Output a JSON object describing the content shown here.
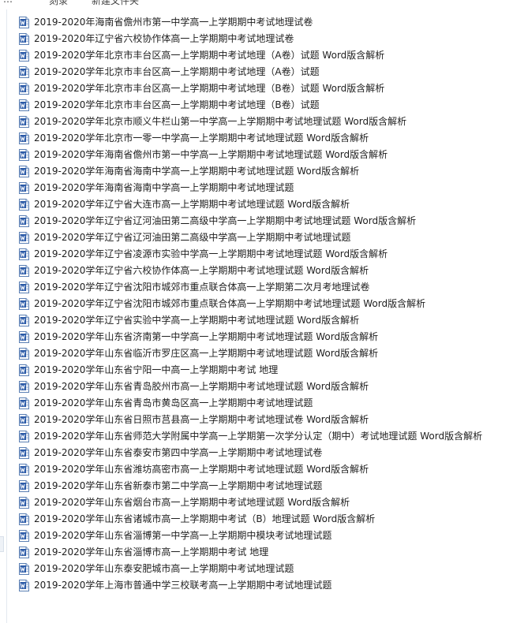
{
  "toolbar": {
    "partial_labels": [
      "…",
      "刻录",
      "新建文件夹"
    ]
  },
  "file_list": {
    "icon": "word-document-icon",
    "items": [
      "2019-2020年海南省儋州市第一中学高一上学期期中考试地理试卷",
      "2019-2020年辽宁省六校协作体高一上学期期中考试地理试卷",
      "2019-2020学年北京市丰台区高一上学期期中考试地理（A卷）试题 Word版含解析",
      "2019-2020学年北京市丰台区高一上学期期中考试地理（A卷）试题",
      "2019-2020学年北京市丰台区高一上学期期中考试地理（B卷）试题 Word版含解析",
      "2019-2020学年北京市丰台区高一上学期期中考试地理（B卷）试题",
      "2019-2020学年北京市顺义牛栏山第一中学高一上学期期中考试地理试题 Word版含解析",
      "2019-2020学年北京市一零一中学高一上学期期中考试地理试题 Word版含解析",
      "2019-2020学年海南省儋州市第一中学高一上学期期中考试地理试题 Word版含解析",
      "2019-2020学年海南省海南中学高一上学期期中考试地理试题 Word版含解析",
      "2019-2020学年海南省海南中学高一上学期期中考试地理试题",
      "2019-2020学年辽宁省大连市高一上学期期中考试地理试题 Word版含解析",
      "2019-2020学年辽宁省辽河油田第二高级中学高一上学期期中考试地理试题 Word版含解析",
      "2019-2020学年辽宁省辽河油田第二高级中学高一上学期期中考试地理试题",
      "2019-2020学年辽宁省凌源市实验中学高一上学期期中考试地理试题 Word版含解析",
      "2019-2020学年辽宁省六校协作体高一上学期期中考试地理试题 Word版含解析",
      "2019-2020学年辽宁省沈阳市城郊市重点联合体高一上学期第二次月考地理试卷",
      "2019-2020学年辽宁省沈阳市城郊市重点联合体高一上学期期中考试地理试题 Word版含解析",
      "2019-2020学年辽宁省实验中学高一上学期期中考试地理试题 Word版含解析",
      "2019-2020学年山东省济南第一中学高一上学期期中考试地理试题 Word版含解析",
      "2019-2020学年山东省临沂市罗庄区高一上学期期中考试地理试题 Word版含解析",
      "2019-2020学年山东省宁阳一中高一上学期期中考试 地理",
      "2019-2020学年山东省青岛胶州市高一上学期期中考试地理试题 Word版含解析",
      "2019-2020学年山东省青岛市黄岛区高一上学期期中考试地理试题",
      "2019-2020学年山东省日照市莒县高一上学期期中考试地理试卷 Word版含解析",
      "2019-2020学年山东省师范大学附属中学高一上学期第一次学分认定（期中）考试地理试题 Word版含解析",
      "2019-2020学年山东省泰安市第四中学高一上学期期中考试地理试卷",
      "2019-2020学年山东省潍坊高密市高一上学期期中考试地理试题 Word版含解析",
      "2019-2020学年山东省新泰市第二中学高一上学期期中考试地理试题",
      "2019-2020学年山东省烟台市高一上学期期中考试地理试题 Word版含解析",
      "2019-2020学年山东省诸城市高一上学期期中考试（B）地理试题 Word版含解析",
      "2019-2020学年山东省淄博第一中学高一上学期期中模块考试地理试题",
      "2019-2020学年山东省淄博市高一上学期期中考试 地理",
      "2019-2020学年山东泰安肥城市高一上学期期中考试地理试题",
      "2019-2020学年上海市普通中学三校联考高一上学期期中考试地理试题"
    ]
  }
}
